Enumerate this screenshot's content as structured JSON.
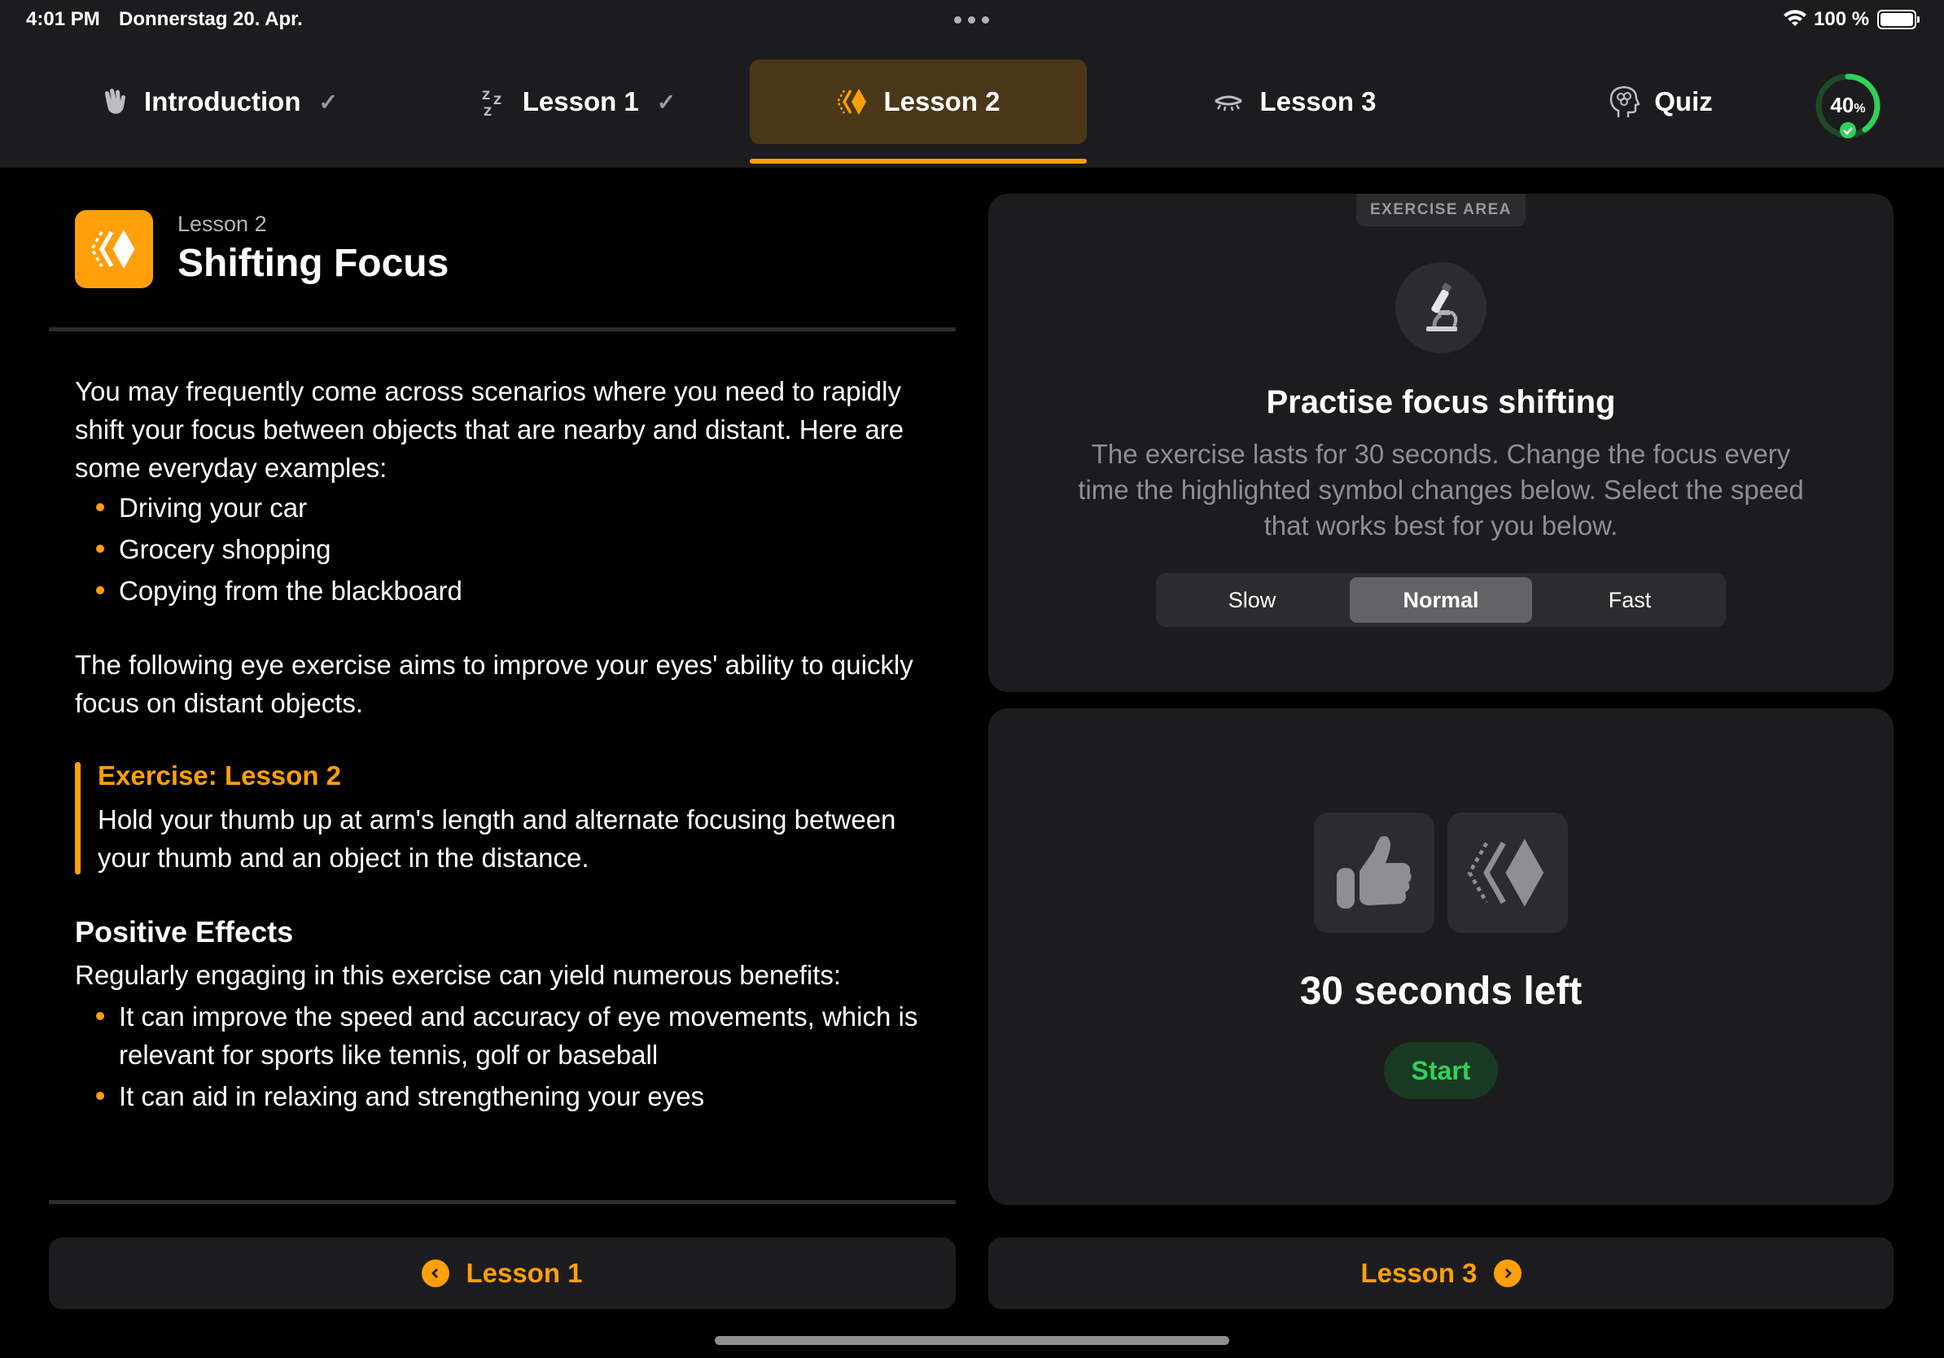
{
  "status_bar": {
    "time": "4:01 PM",
    "date": "Donnerstag 20. Apr.",
    "battery": "100 %"
  },
  "tabs": [
    {
      "label": "Introduction",
      "icon": "hand-wave-icon",
      "completed": true
    },
    {
      "label": "Lesson 1",
      "icon": "zzz-sleep-icon",
      "completed": true
    },
    {
      "label": "Lesson 2",
      "icon": "focus-diamond-icon",
      "completed": false,
      "active": true
    },
    {
      "label": "Lesson 3",
      "icon": "closed-eye-icon",
      "completed": false
    },
    {
      "label": "Quiz",
      "icon": "brain-head-icon",
      "completed": false
    }
  ],
  "progress": {
    "value": "40",
    "unit": "%",
    "fraction": 0.4
  },
  "lesson": {
    "subtitle": "Lesson 2",
    "title": "Shifting Focus",
    "intro": "You may frequently come across scenarios where you need to rapidly shift your focus between objects that are nearby and distant. Here are some everyday examples:",
    "examples": [
      "Driving your car",
      "Grocery shopping",
      "Copying from the blackboard"
    ],
    "aim": "The following eye exercise aims to improve your eyes' ability to quickly focus on distant objects.",
    "exercise_title": "Exercise: Lesson 2",
    "exercise_text": "Hold your thumb up at arm's length and alternate focusing between your thumb and an object in the distance.",
    "effects_heading": "Positive Effects",
    "effects_intro": "Regularly engaging in this exercise can yield numerous benefits:",
    "effects": [
      "It can improve the speed and accuracy of eye movements, which is relevant for sports like tennis, golf or baseball",
      "It can aid in relaxing and strengthening your eyes"
    ]
  },
  "exercise_area": {
    "badge": "EXERCISE AREA",
    "icon": "microscope-icon",
    "title": "Practise focus shifting",
    "description": "The exercise lasts for 30 seconds. Change the focus every time the highlighted symbol changes below. Select the speed that works best for you below.",
    "speeds": [
      "Slow",
      "Normal",
      "Fast"
    ],
    "selected_speed": "Normal"
  },
  "timer": {
    "symbols": [
      "thumbs-up-icon",
      "focus-diamond-icon"
    ],
    "remaining": "30 seconds left",
    "start_label": "Start"
  },
  "navigation": {
    "prev_label": "Lesson 1",
    "next_label": "Lesson 3"
  },
  "colors": {
    "accent": "#ff9f0a",
    "success": "#30d158",
    "card": "#1c1c1e",
    "background": "#000000"
  }
}
